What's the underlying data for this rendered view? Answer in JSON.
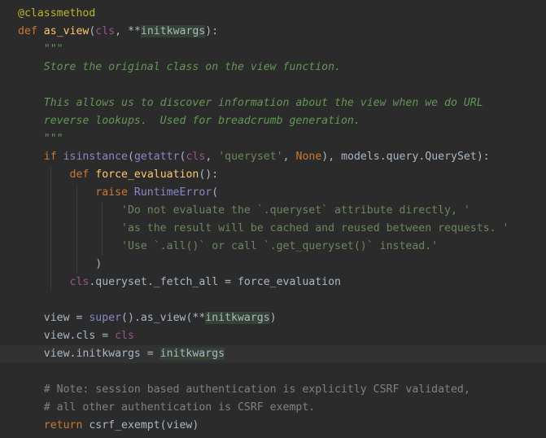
{
  "editor": {
    "theme": "Darcula",
    "colors": {
      "background": "#2b2b2b",
      "keyword": "#cc7832",
      "function_name": "#ffc66d",
      "string": "#6a8759",
      "docstring": "#629755",
      "comment": "#808080",
      "decorator": "#bbb529",
      "self_param": "#94558d",
      "builtin": "#8888c6"
    },
    "current_line": 19,
    "lines": [
      [
        [
          "decorator",
          "@classmethod"
        ]
      ],
      [
        [
          "kw",
          "def "
        ],
        [
          "fn",
          "as_view"
        ],
        [
          "plain",
          "("
        ],
        [
          "selfp",
          "cls"
        ],
        [
          "plain",
          ", **"
        ],
        [
          "hl",
          "initkwargs"
        ],
        [
          "plain",
          "):"
        ]
      ],
      [
        [
          "plain",
          "    "
        ],
        [
          "doc",
          "\"\"\""
        ]
      ],
      [
        [
          "plain",
          "    "
        ],
        [
          "doc",
          "Store the original class on the view function."
        ]
      ],
      [],
      [
        [
          "plain",
          "    "
        ],
        [
          "doc",
          "This allows us to discover information about the view when we do URL"
        ]
      ],
      [
        [
          "plain",
          "    "
        ],
        [
          "doc",
          "reverse lookups.  Used for breadcrumb generation."
        ]
      ],
      [
        [
          "plain",
          "    "
        ],
        [
          "doc",
          "\"\"\""
        ]
      ],
      [
        [
          "plain",
          "    "
        ],
        [
          "kw",
          "if "
        ],
        [
          "builtin",
          "isinstance"
        ],
        [
          "plain",
          "("
        ],
        [
          "builtin",
          "getattr"
        ],
        [
          "plain",
          "("
        ],
        [
          "selfp",
          "cls"
        ],
        [
          "plain",
          ", "
        ],
        [
          "str",
          "'queryset'"
        ],
        [
          "plain",
          ", "
        ],
        [
          "kw",
          "None"
        ],
        [
          "plain",
          "), models.query.QuerySet):"
        ]
      ],
      [
        [
          "plain",
          "        "
        ],
        [
          "kw",
          "def "
        ],
        [
          "fn",
          "force_evaluation"
        ],
        [
          "plain",
          "():"
        ]
      ],
      [
        [
          "plain",
          "            "
        ],
        [
          "kw",
          "raise "
        ],
        [
          "builtin",
          "RuntimeError"
        ],
        [
          "plain",
          "("
        ]
      ],
      [
        [
          "plain",
          "                "
        ],
        [
          "str",
          "'Do not evaluate the `.queryset` attribute directly, '"
        ]
      ],
      [
        [
          "plain",
          "                "
        ],
        [
          "str",
          "'as the result will be cached and reused between requests. '"
        ]
      ],
      [
        [
          "plain",
          "                "
        ],
        [
          "str",
          "'Use `.all()` or call `.get_queryset()` instead.'"
        ]
      ],
      [
        [
          "plain",
          "            )"
        ]
      ],
      [
        [
          "plain",
          "        "
        ],
        [
          "selfp",
          "cls"
        ],
        [
          "plain",
          ".queryset._fetch_all = force_evaluation"
        ]
      ],
      [],
      [
        [
          "plain",
          "    view = "
        ],
        [
          "builtin",
          "super"
        ],
        [
          "plain",
          "().as_view(**"
        ],
        [
          "hl",
          "initkwargs"
        ],
        [
          "plain",
          ")"
        ]
      ],
      [
        [
          "plain",
          "    view.cls = "
        ],
        [
          "selfp",
          "cls"
        ]
      ],
      [
        [
          "plain",
          "    view.initkwargs = "
        ],
        [
          "hl",
          "initkwargs"
        ]
      ],
      [],
      [
        [
          "plain",
          "    "
        ],
        [
          "comment",
          "# Note: session based authentication is explicitly CSRF validated,"
        ]
      ],
      [
        [
          "plain",
          "    "
        ],
        [
          "comment",
          "# all other authentication is CSRF exempt."
        ]
      ],
      [
        [
          "plain",
          "    "
        ],
        [
          "kw",
          "return "
        ],
        [
          "plain",
          "csrf_exempt(view)"
        ]
      ]
    ]
  }
}
